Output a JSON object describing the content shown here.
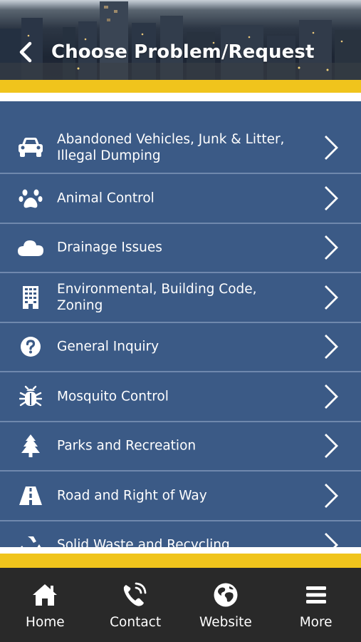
{
  "header": {
    "title": "Choose Problem/Request"
  },
  "colors": {
    "accent_yellow": "#f0c41c",
    "list_bg": "#3b5a86",
    "divider": "#6f88ad",
    "nav_bg": "#292929"
  },
  "categories": [
    {
      "label": "Abandoned Vehicles, Junk & Litter, Illegal Dumping",
      "icon": "car-icon"
    },
    {
      "label": "Animal Control",
      "icon": "paw-icon"
    },
    {
      "label": "Drainage Issues",
      "icon": "cloud-icon"
    },
    {
      "label": "Environmental, Building Code, Zoning",
      "icon": "building-icon"
    },
    {
      "label": "General Inquiry",
      "icon": "question-circle-icon"
    },
    {
      "label": "Mosquito Control",
      "icon": "bug-icon"
    },
    {
      "label": "Parks and Recreation",
      "icon": "tree-icon"
    },
    {
      "label": "Road and Right of Way",
      "icon": "road-icon"
    },
    {
      "label": "Solid Waste and Recycling",
      "icon": "recycle-icon"
    }
  ],
  "bottom_nav": [
    {
      "label": "Home",
      "icon": "home-icon"
    },
    {
      "label": "Contact",
      "icon": "phone-icon"
    },
    {
      "label": "Website",
      "icon": "globe-icon"
    },
    {
      "label": "More",
      "icon": "menu-icon"
    }
  ]
}
